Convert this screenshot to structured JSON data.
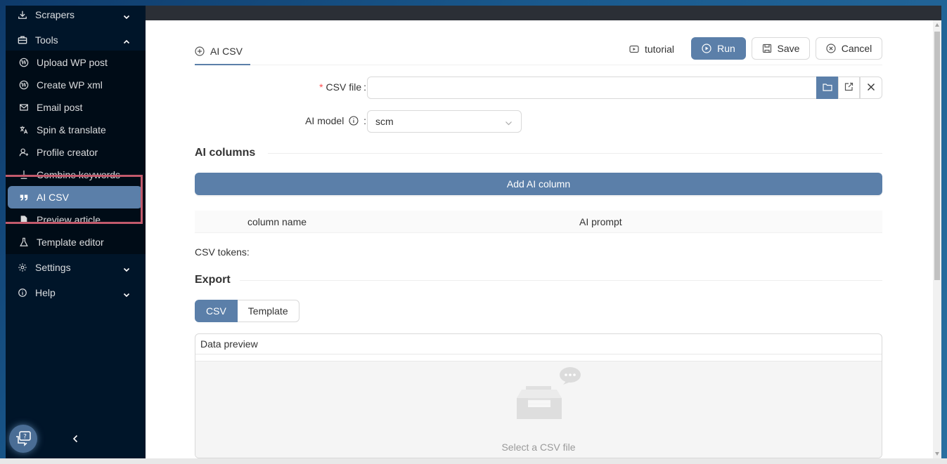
{
  "sidebar": {
    "items": [
      {
        "label": "Scrapers",
        "icon": "download-icon",
        "expandable": true,
        "expanded": false
      },
      {
        "label": "Tools",
        "icon": "toolbox-icon",
        "expandable": true,
        "expanded": true
      },
      {
        "label": "Upload WP post",
        "icon": "wordpress-icon"
      },
      {
        "label": "Create WP xml",
        "icon": "wordpress-icon"
      },
      {
        "label": "Email post",
        "icon": "email-icon"
      },
      {
        "label": "Spin & translate",
        "icon": "translate-icon"
      },
      {
        "label": "Profile creator",
        "icon": "user-add-icon"
      },
      {
        "label": "Combine keywords",
        "icon": "merge-icon"
      },
      {
        "label": "AI CSV",
        "icon": "quote-icon",
        "selected": true
      },
      {
        "label": "Preview article",
        "icon": "file-icon"
      },
      {
        "label": "Template editor",
        "icon": "flask-icon"
      },
      {
        "label": "Settings",
        "icon": "gear-icon",
        "expandable": true,
        "expanded": false
      },
      {
        "label": "Help",
        "icon": "info-icon",
        "expandable": true,
        "expanded": false
      }
    ],
    "collapse_icon": "chevron-left-icon",
    "support_icon": "chat-help-icon"
  },
  "tabs": [
    {
      "label": "AI CSV",
      "icon": "plus-circle-icon",
      "active": true
    }
  ],
  "toolbar": {
    "tutorial_label": "tutorial",
    "run_label": "Run",
    "save_label": "Save",
    "cancel_label": "Cancel"
  },
  "form": {
    "csv_file_label": "CSV file",
    "csv_file_value": "",
    "csv_file_required": "*",
    "ai_model_label": "AI model",
    "ai_model_value": "scm",
    "label_colon": ":"
  },
  "ai_columns": {
    "title": "AI columns",
    "add_label": "Add AI column",
    "headers": [
      "column name",
      "AI prompt"
    ]
  },
  "csv_tokens_label": "CSV tokens:",
  "export": {
    "title": "Export",
    "options": [
      "CSV",
      "Template"
    ],
    "selected": "CSV"
  },
  "preview": {
    "title": "Data preview",
    "empty_text": "Select a CSV file"
  },
  "colors": {
    "sidebar_bg": "#001529",
    "accent": "#5b7fa9",
    "highlight_outline": "#c25a6c"
  }
}
